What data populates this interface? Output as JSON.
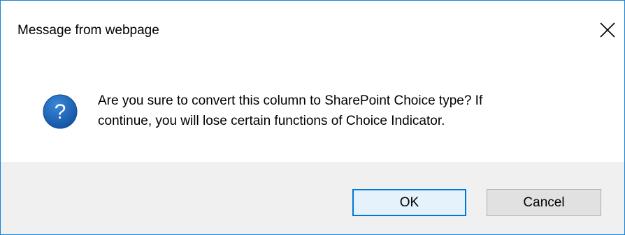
{
  "dialog": {
    "title": "Message from webpage",
    "message_line1": "Are you sure to convert this column to SharePoint Choice type? If",
    "message_line2": "continue, you will lose certain functions of Choice Indicator.",
    "ok_label": "OK",
    "cancel_label": "Cancel",
    "icon": "question-icon",
    "close_icon": "close-icon"
  },
  "colors": {
    "border": "#1883d7",
    "icon_blue": "#1d64b4",
    "footer_bg": "#f0f0f0",
    "default_button_border": "#0078d7"
  }
}
